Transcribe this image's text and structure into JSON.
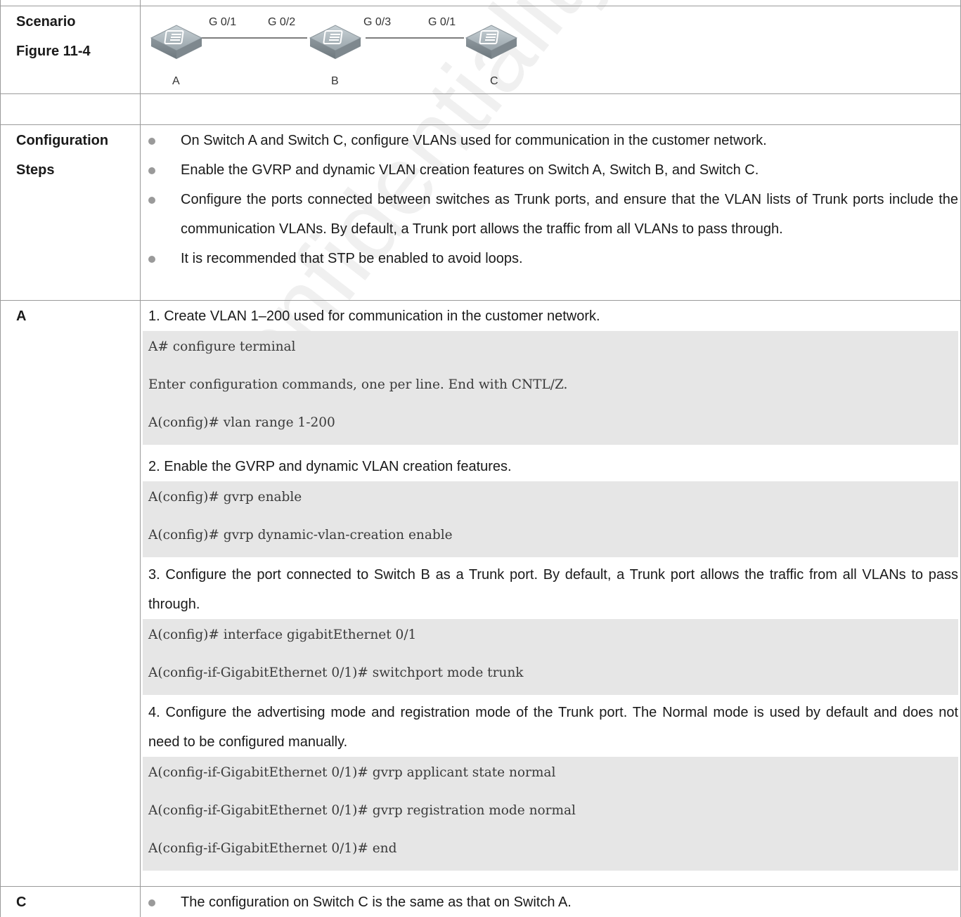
{
  "rows": {
    "scenario": {
      "label_line1": "Scenario",
      "label_line2": "Figure 11-4",
      "diagram": {
        "nodes": [
          "A",
          "B",
          "C"
        ],
        "ports": [
          "G 0/1",
          "G 0/2",
          "G 0/3",
          "G 0/1"
        ]
      }
    },
    "configuration": {
      "label_line1": "Configuration",
      "label_line2": "Steps",
      "bullets": [
        "On Switch A and Switch C, configure VLANs used for communication in the customer network.",
        "Enable the GVRP and dynamic VLAN creation features on Switch A, Switch B, and Switch C.",
        "Configure the ports connected between switches as Trunk ports, and ensure that the VLAN lists of Trunk ports include the communication VLANs. By default, a Trunk port allows the traffic from all VLANs to pass through.",
        "It is recommended that STP be enabled to avoid loops."
      ]
    },
    "switch_a": {
      "label": "A",
      "steps": [
        {
          "text": "1. Create VLAN 1–200 used for communication in the customer network.",
          "code": [
            "A# configure terminal",
            "Enter configuration commands, one per line. End with CNTL/Z.",
            "A(config)# vlan range 1-200"
          ]
        },
        {
          "text": "2. Enable the GVRP and dynamic VLAN creation features.",
          "code": [
            "A(config)# gvrp enable",
            "A(config)# gvrp dynamic-vlan-creation enable"
          ]
        },
        {
          "text": "3. Configure the port connected to Switch B as a Trunk port. By default, a Trunk port allows the traffic from all VLANs to pass through.",
          "code": [
            "A(config)# interface gigabitEthernet 0/1",
            "A(config-if-GigabitEthernet 0/1)# switchport mode trunk"
          ]
        },
        {
          "text": "4. Configure the advertising mode and registration mode of the Trunk port. The Normal mode is used by default and does not need to be configured manually.",
          "code": [
            "A(config-if-GigabitEthernet 0/1)# gvrp applicant state normal",
            "A(config-if-GigabitEthernet 0/1)# gvrp registration mode normal",
            "A(config-if-GigabitEthernet 0/1)# end"
          ]
        }
      ]
    },
    "switch_c": {
      "label": "C",
      "bullet": "The configuration on Switch C is the same as that on Switch A."
    }
  },
  "watermark": "Confidentiality: Controlled"
}
